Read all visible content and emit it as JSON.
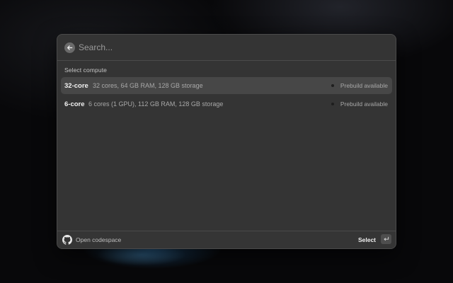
{
  "search": {
    "placeholder": "Search..."
  },
  "section": {
    "label": "Select compute"
  },
  "machines": [
    {
      "name": "32-core",
      "description": "32 cores, 64 GB RAM, 128 GB storage",
      "status": "Prebuild available",
      "selected": true
    },
    {
      "name": "6-core",
      "description": "6 cores (1 GPU), 112 GB RAM, 128 GB storage",
      "status": "Prebuild available",
      "selected": false
    }
  ],
  "footer": {
    "action_label": "Open codespace",
    "select_label": "Select"
  },
  "icons": {
    "back": "arrow-left-icon",
    "brand": "github-icon",
    "enter": "enter-key-icon",
    "status": "status-dot-icon"
  },
  "colors": {
    "panel": "#343434",
    "selected_row": "#474747",
    "border": "#4a4a4a",
    "text_primary": "#f2f2f2",
    "text_secondary": "#a8a8a8"
  }
}
